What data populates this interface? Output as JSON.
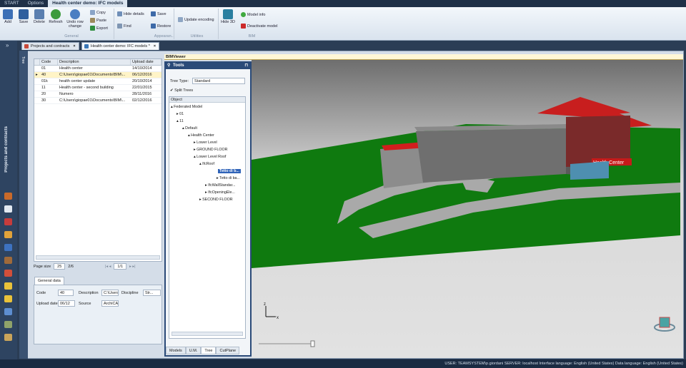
{
  "ribbon_tabs": [
    "START",
    "Options",
    "Health center demo: IFC models"
  ],
  "ribbon": {
    "add": "Add",
    "save": "Save",
    "delete": "Delete",
    "refresh": "Refresh",
    "undo": "Undo row change",
    "copy": "Copy",
    "paste": "Paste",
    "export": "Export",
    "hide_details": "Hide details",
    "find": "Find",
    "save2": "Save",
    "restore": "Restore",
    "update_encoding": "Update encoding",
    "hide3d": "Hide 3D",
    "model_info": "Model info",
    "deactivate_model": "Deactivate model",
    "group_general": "General",
    "group_appearance": "Appearan...",
    "group_utilities": "Utilities",
    "group_bim": "BIM"
  },
  "leftnav": {
    "label": "Projects and contracts"
  },
  "doctabs": [
    {
      "label": "Projects and contracts",
      "active": false
    },
    {
      "label": "Health center demo: IFC models *",
      "active": true
    }
  ],
  "treeside": "Tree",
  "grid": {
    "columns": [
      "Code",
      "Description",
      "Upload date"
    ],
    "rows": [
      {
        "code": "01",
        "desc": "Health center",
        "date": "14/10/2014"
      },
      {
        "code": "40",
        "desc": "C:\\Users\\giopae01\\Documents\\BIM\\...",
        "date": "06/12/2016"
      },
      {
        "code": "01k",
        "desc": "health center update",
        "date": "20/10/2014"
      },
      {
        "code": "11",
        "desc": "Health center - second building",
        "date": "22/01/2015"
      },
      {
        "code": "20",
        "desc": "Numero",
        "date": "28/11/2016"
      },
      {
        "code": "30",
        "desc": "C:\\Users\\giopae01\\Documents\\BIM\\...",
        "date": "02/12/2016"
      }
    ]
  },
  "pager": {
    "label": "Page size",
    "size": "25",
    "count": "2/6",
    "page": "1/1"
  },
  "general_data": {
    "tab": "General data",
    "code_label": "Code",
    "code_value": "40",
    "desc_label": "Description",
    "desc_value": "C:\\Users",
    "disc_label": "Discipline",
    "disc_value": "Str...",
    "upload_label": "Upload date",
    "upload_value": "06/12",
    "source_label": "Source",
    "source_value": "ArchiCAD"
  },
  "bim": {
    "title": "BIMViewer",
    "building_sign": "Health Center"
  },
  "tools": {
    "title": "Tools",
    "tree_type_label": "Tree Type:",
    "tree_type_value": "Standard",
    "split_trees": "Split Trees",
    "object_header": "Object",
    "nodes": [
      "Federated Model",
      "01",
      "11",
      "Default",
      "Health Center",
      "Lower Level",
      "GROUND FLOOR",
      "Lower Level Roof",
      "IfcRoof",
      "Tetto di b...",
      "Tetto di ba...",
      "IfcWallStandar...",
      "IfcOpeningEle...",
      "SECOND FLOOR"
    ],
    "tabs": [
      "Models",
      "U.M.",
      "Tree",
      "CutPlane"
    ]
  },
  "status": "USER: TEAMSYSTEM\\p.giordani   SERVER: localhost   Interface language: English (United States)   Data language: English (United States)"
}
